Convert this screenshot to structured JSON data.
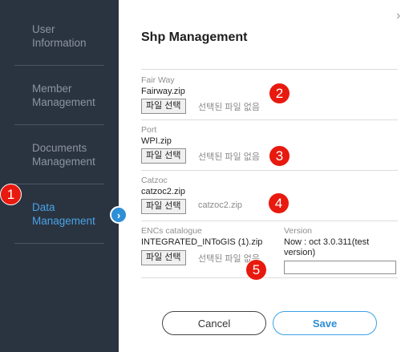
{
  "sidebar": {
    "items": [
      {
        "label": "User\nInformation"
      },
      {
        "label": "Member\nManagement"
      },
      {
        "label": "Documents\nManagement"
      },
      {
        "label": "Data\nManagement"
      }
    ],
    "expand_icon": "chevron-right-icon"
  },
  "annotations": [
    "1",
    "2",
    "3",
    "4",
    "5"
  ],
  "close_icon": "›",
  "main": {
    "title": "Shp Management",
    "fairway": {
      "label": "Fair Way",
      "file": "Fairway.zip",
      "button": "파일 선택",
      "status": "선택된 파일 없음"
    },
    "port": {
      "label": "Port",
      "file": "WPI.zip",
      "button": "파일 선택",
      "status": "선택된 파일 없음"
    },
    "catzoc": {
      "label": "Catzoc",
      "file": "catzoc2.zip",
      "button": "파일 선택",
      "status": "catzoc2.zip"
    },
    "enc": {
      "label": "ENCs catalogue",
      "file": "INTEGRATED_INToGIS (1).zip",
      "button": "파일 선택",
      "status": "선택된 파일 없음"
    },
    "version": {
      "label": "Version",
      "value": "Now : oct 3.0.311(test version)",
      "input_value": ""
    }
  },
  "actions": {
    "cancel": "Cancel",
    "save": "Save"
  },
  "colors": {
    "sidebar_bg": "#2a3441",
    "accent": "#2d8fd6",
    "badge": "#e8190e"
  }
}
